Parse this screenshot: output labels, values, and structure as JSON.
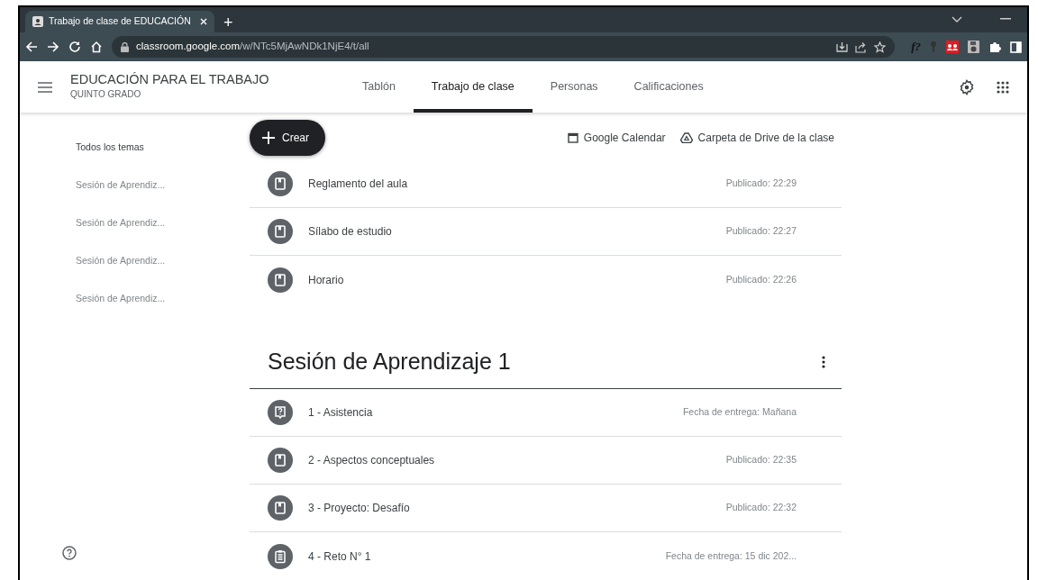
{
  "browser": {
    "tab_title": "Trabajo de clase de EDUCACIÓN",
    "new_tab": "+",
    "url_host": "classroom.google.com",
    "url_path": "/w/NTc5MjAwNDk1NjE4/t/all",
    "extension_text": "f?"
  },
  "class": {
    "name": "EDUCACIÓN PARA EL TRABAJO",
    "section": "QUINTO GRADO"
  },
  "tabs": [
    {
      "label": "Tablón",
      "selected": false
    },
    {
      "label": "Trabajo de clase",
      "selected": true
    },
    {
      "label": "Personas",
      "selected": false
    },
    {
      "label": "Calificaciones",
      "selected": false
    }
  ],
  "create_button": "Crear",
  "links": [
    {
      "kind": "calendar",
      "label": "Google Calendar"
    },
    {
      "kind": "drive",
      "label": "Carpeta de Drive de la clase"
    }
  ],
  "sidebar": {
    "items": [
      {
        "label": "Todos los temas",
        "selected": true
      },
      {
        "label": "Sesión de Aprendiz...",
        "selected": false
      },
      {
        "label": "Sesión de Aprendiz...",
        "selected": false
      },
      {
        "label": "Sesión de Aprendiz...",
        "selected": false
      },
      {
        "label": "Sesión de Aprendiz...",
        "selected": false
      }
    ]
  },
  "ungrouped": [
    {
      "kind": "material",
      "title": "Reglamento del aula",
      "meta": "Publicado: 22:29"
    },
    {
      "kind": "material",
      "title": "Sílabo de estudio",
      "meta": "Publicado: 22:27"
    },
    {
      "kind": "material",
      "title": "Horario",
      "meta": "Publicado: 22:26"
    }
  ],
  "topics": [
    {
      "title": "Sesión de Aprendizaje 1",
      "items": [
        {
          "kind": "question",
          "title": "1 - Asistencia",
          "meta": "Fecha de entrega: Mañana"
        },
        {
          "kind": "material",
          "title": "2 - Aspectos conceptuales",
          "meta": "Publicado: 22:35"
        },
        {
          "kind": "material",
          "title": "3 - Proyecto: Desafío",
          "meta": "Publicado: 22:32"
        },
        {
          "kind": "assignment",
          "title": "4 - Reto N° 1",
          "meta": "Fecha de entrega: 15 dic 202..."
        }
      ]
    }
  ]
}
